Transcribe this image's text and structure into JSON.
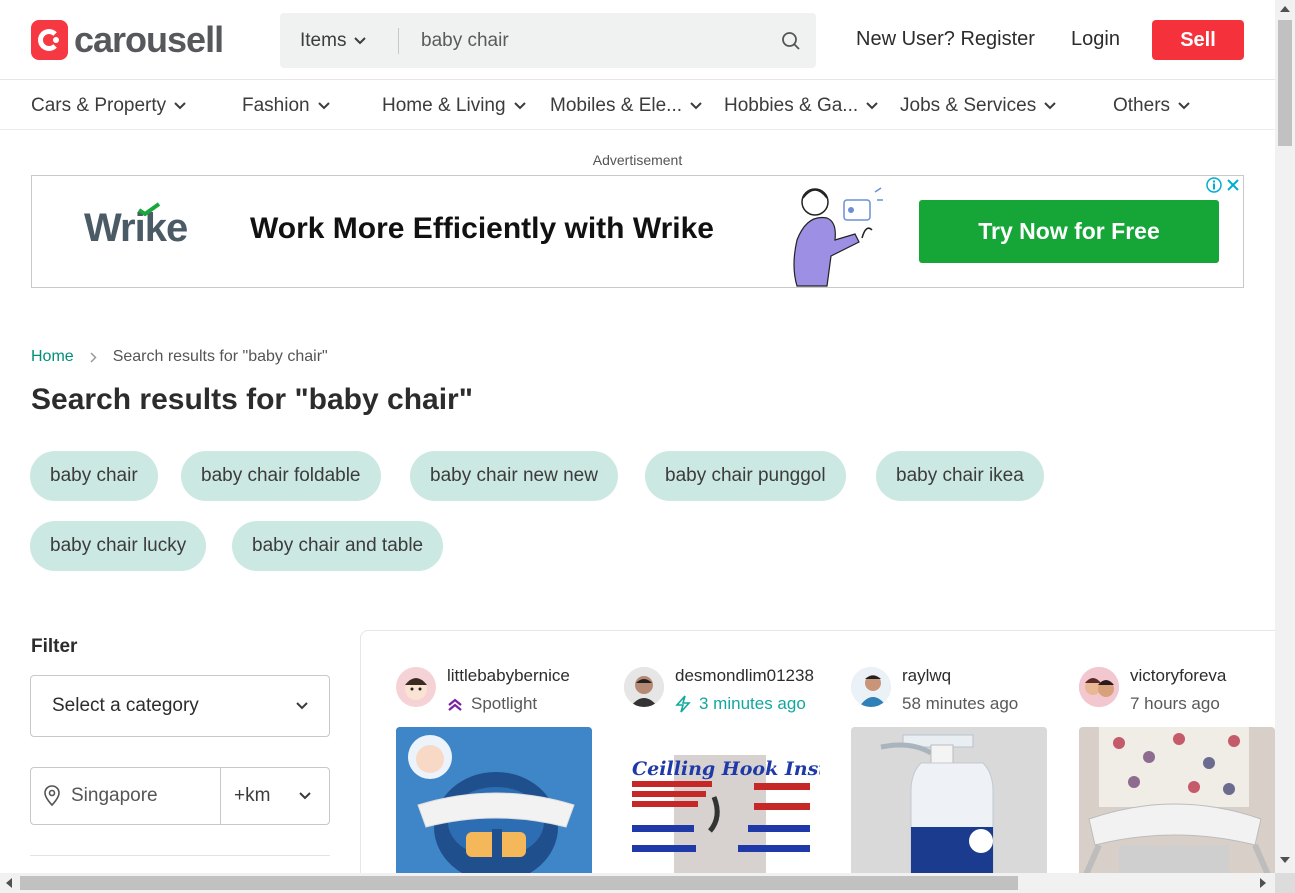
{
  "header": {
    "logo_text": "carousell",
    "search_category": "Items",
    "search_value": "baby chair",
    "register_label": "New User? Register",
    "login_label": "Login",
    "sell_label": "Sell"
  },
  "categories": [
    "Cars & Property",
    "Fashion",
    "Home & Living",
    "Mobiles & Ele...",
    "Hobbies & Ga...",
    "Jobs & Services",
    "Others"
  ],
  "ad": {
    "label": "Advertisement",
    "brand": "Wrike",
    "headline": "Work More Efficiently with Wrike",
    "cta": "Try Now for Free"
  },
  "breadcrumb": {
    "home": "Home",
    "current": "Search results for \"baby chair\""
  },
  "page_title": "Search results for \"baby chair\"",
  "suggestions": [
    "baby chair",
    "baby chair foldable",
    "baby chair new new",
    "baby chair punggol",
    "baby chair ikea",
    "baby chair lucky",
    "baby chair and table"
  ],
  "filter": {
    "title": "Filter",
    "category_placeholder": "Select a category",
    "location": "Singapore",
    "distance": "+km"
  },
  "listings": [
    {
      "username": "littlebabybernice",
      "meta": "Spotlight",
      "meta_icon": "spotlight-icon"
    },
    {
      "username": "desmondlim01238",
      "meta": "3 minutes ago",
      "meta_icon": "bolt-icon"
    },
    {
      "username": "raylwq",
      "meta": "58 minutes ago"
    },
    {
      "username": "victoryforeva",
      "meta": "7 hours ago"
    }
  ],
  "colors": {
    "brand_red": "#f5323c",
    "teal": "#008f79",
    "chip_bg": "#cce8e2",
    "ad_cta": "#15a637"
  }
}
